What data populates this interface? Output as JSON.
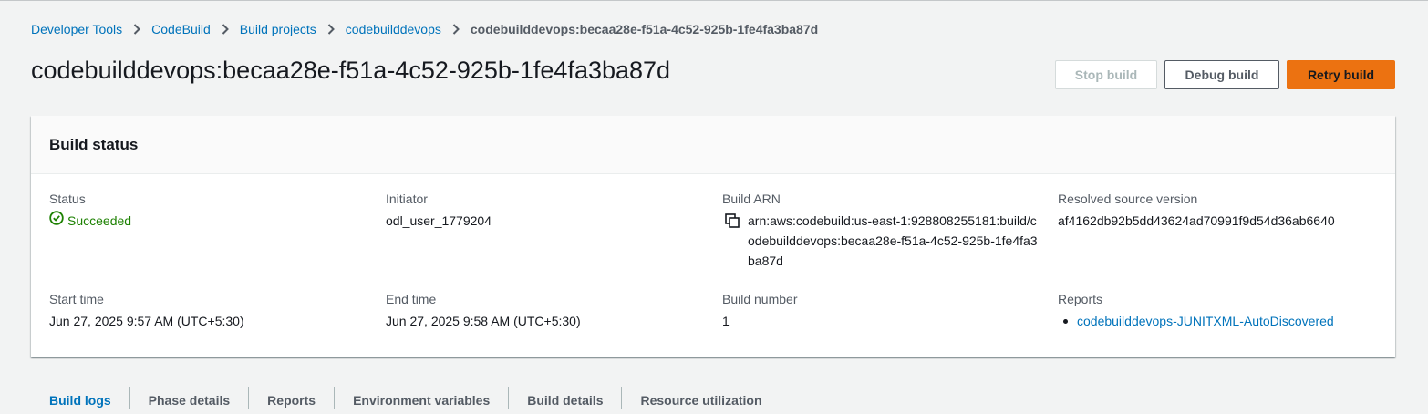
{
  "breadcrumb": {
    "items": [
      "Developer Tools",
      "CodeBuild",
      "Build projects",
      "codebuilddevops"
    ],
    "current": "codebuilddevops:becaa28e-f51a-4c52-925b-1fe4fa3ba87d"
  },
  "header": {
    "title": "codebuilddevops:becaa28e-f51a-4c52-925b-1fe4fa3ba87d",
    "stop_label": "Stop build",
    "debug_label": "Debug build",
    "retry_label": "Retry build"
  },
  "build_status": {
    "title": "Build status",
    "status_label": "Status",
    "status_value": "Succeeded",
    "initiator_label": "Initiator",
    "initiator_value": "odl_user_1779204",
    "arn_label": "Build ARN",
    "arn_value": "arn:aws:codebuild:us-east-1:928808255181:build/codebuilddevops:becaa28e-f51a-4c52-925b-1fe4fa3ba87d",
    "resolved_label": "Resolved source version",
    "resolved_value": "af4162db92b5dd43624ad70991f9d54d36ab6640",
    "start_label": "Start time",
    "start_value": "Jun 27, 2025 9:57 AM (UTC+5:30)",
    "end_label": "End time",
    "end_value": "Jun 27, 2025 9:58 AM (UTC+5:30)",
    "number_label": "Build number",
    "number_value": "1",
    "reports_label": "Reports",
    "reports": [
      "codebuilddevops-JUNITXML-AutoDiscovered"
    ]
  },
  "tabs": [
    "Build logs",
    "Phase details",
    "Reports",
    "Environment variables",
    "Build details",
    "Resource utilization"
  ],
  "colors": {
    "accent": "#ec7211",
    "link": "#0073bb",
    "success": "#1d8102"
  },
  "icons": {
    "separator": "chevron-right-icon",
    "status": "check-circle-icon",
    "copy": "copy-icon"
  }
}
